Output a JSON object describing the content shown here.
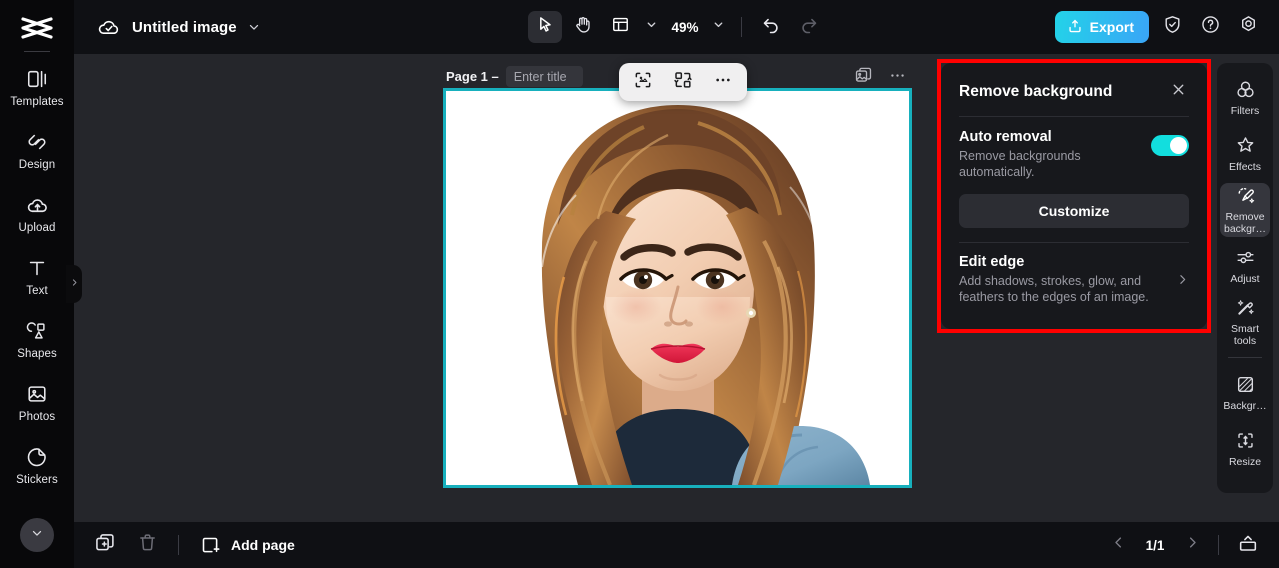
{
  "app": {
    "brand_icon": "capcut-logo-icon",
    "background": "#0b0b0d",
    "accent_cyan": "#12dede",
    "accent_export_from": "#23d3e8",
    "accent_export_to": "#3aa5f7",
    "selection_border": "#17b0bd",
    "highlight_box": "#ff0000"
  },
  "left_rail": {
    "items": [
      {
        "label": "Templates",
        "icon": "templates-icon"
      },
      {
        "label": "Design",
        "icon": "design-icon"
      },
      {
        "label": "Upload",
        "icon": "upload-cloud-icon"
      },
      {
        "label": "Text",
        "icon": "text-icon"
      },
      {
        "label": "Shapes",
        "icon": "shapes-icon"
      },
      {
        "label": "Photos",
        "icon": "photos-icon"
      },
      {
        "label": "Stickers",
        "icon": "stickers-icon"
      }
    ],
    "scroll_down_icon": "chevron-down-icon",
    "expand_handle_icon": "chevron-right-icon"
  },
  "topbar": {
    "cloud_icon": "cloud-saved-icon",
    "doc_title": "Untitled image",
    "title_caret_icon": "chevron-down-icon",
    "select_tool_icon": "cursor-arrow-icon",
    "hand_tool_icon": "hand-icon",
    "layout_tool_icon": "layout-panel-icon",
    "layout_caret_icon": "chevron-down-icon",
    "zoom_value": "49%",
    "zoom_caret_icon": "chevron-down-icon",
    "undo_icon": "undo-icon",
    "redo_icon": "redo-icon",
    "export_label": "Export",
    "export_icon": "export-upload-icon",
    "shield_icon": "shield-check-icon",
    "help_icon": "question-circle-icon",
    "settings_icon": "gear-icon"
  },
  "canvas": {
    "page_label": "Page 1 –",
    "title_placeholder": "Enter title",
    "title_value": "",
    "float_toolbar": {
      "crop_icon": "crop-select-icon",
      "replace_icon": "replace-swap-icon",
      "more_icon": "more-horizontal-icon"
    },
    "duplicate_icon": "duplicate-image-icon",
    "more_icon": "more-horizontal-icon"
  },
  "right_panel": {
    "title": "Remove background",
    "close_icon": "close-icon",
    "auto_removal": {
      "title": "Auto removal",
      "description": "Remove backgrounds automatically.",
      "toggle_on": true,
      "customize_label": "Customize"
    },
    "edit_edge": {
      "title": "Edit edge",
      "description": "Add shadows, strokes, glow, and feathers to the edges of an image.",
      "chevron_icon": "chevron-right-icon"
    }
  },
  "right_rail": {
    "items": [
      {
        "label": "Filters",
        "icon": "filters-icon",
        "active": false
      },
      {
        "label": "Effects",
        "icon": "effects-star-icon",
        "active": false
      },
      {
        "label": "Remove backgr…",
        "icon": "remove-background-icon",
        "active": true
      },
      {
        "label": "Adjust",
        "icon": "adjust-sliders-icon",
        "active": false
      },
      {
        "label": "Smart tools",
        "icon": "smart-tools-wand-icon",
        "active": false
      },
      {
        "label": "Backgr…",
        "icon": "background-icon",
        "active": false
      },
      {
        "label": "Resize",
        "icon": "resize-icon",
        "active": false
      }
    ]
  },
  "bottombar": {
    "duplicate_page_icon": "duplicate-page-icon",
    "delete_page_icon": "trash-icon",
    "add_page_icon": "add-page-icon",
    "add_page_label": "Add page",
    "prev_icon": "chevron-left-icon",
    "next_icon": "chevron-right-icon",
    "page_indicator": "1/1",
    "timeline_icon": "timeline-expand-icon"
  }
}
